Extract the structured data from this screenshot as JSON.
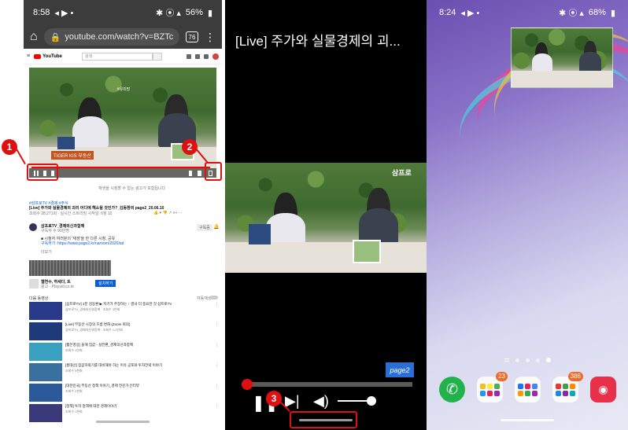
{
  "browser": {
    "status_time": "8:58",
    "status_right": "56%",
    "url": "youtube.com/watch?v=BZTc",
    "tab_count": "76",
    "search_placeholder": "검색"
  },
  "annotations": {
    "badge_1": "1",
    "badge_2": "2",
    "badge_3": "3"
  },
  "video_overlay": {
    "tag_text": "TIGER KIS 부동산",
    "sign_text": "#유미망"
  },
  "page": {
    "banner_text": "재생을 시청할 수 없는 광고가 포함됩니다",
    "video_title": "[Live] 주가와 실물경제의 괴리 어디에 해소될 것인가?_김동환의 page2_20.06.10",
    "video_meta": "조회수 28,271회 · 실시간 스트리밍 시작일: 6월 10",
    "channel_name": "삼프로TV_경제의신과함께",
    "channel_sub": "구독자 수 90만명",
    "subscribe_label": "구독중",
    "desc_line_1": "■ 시청자 여러분의 '재생'을 한 다른 시청, 공유",
    "desc_line_2": "구독하기: https://www.page2.kr/naroom/2020/ad",
    "more_label": "더보기",
    "ad_title": "웹연수, 하세다, 트",
    "ad_sub": "광고 · Playvid.co.kr",
    "ad_button": "설치하기",
    "up_next_label": "다음 동영상",
    "autoplay_label": "자동재생"
  },
  "recommendations": [
    {
      "title": "[삼프로TV] 1분 김동환 ▶ 자기가 주장하는 ↑ 결국 더 중요한 것 삼프로TV",
      "sub": "삼프로TV_경제의신과함께 · 조회수 3만회",
      "thumb": "#2a3a8a"
    },
    {
      "title": "[Live] 부동산 시장의 흐름 변화 (Zoom 회의)",
      "sub": "삼프로TV_경제의신과함께 · 조회수 1.2만회",
      "thumb": "#1e3a7a"
    },
    {
      "title": "[짧은영상] 올해 집값 - 실전편_경제의신과함께",
      "sub": "조회수 1만회",
      "thumb": "#3aa0c0"
    },
    {
      "title": "[홍대선] 집값하락기를 대비해야 하는 이유 공포와 투자전략 이야기",
      "sub": "조회수 5천회",
      "thumb": "#3a70a0"
    },
    {
      "title": "[대한민국] 부동산 정책 이야기_경제 전문가 인터뷰",
      "sub": "조회수 2천회",
      "thumb": "#2a5a9a"
    },
    {
      "title": "[정책] 투자 정책에 대한 경제이야기",
      "sub": "조회수 1천회",
      "thumb": "#3a3a7a"
    }
  ],
  "player": {
    "title": "[Live] 주가와 실물경제의 괴...",
    "logo_text": "page2",
    "progress": 0.02,
    "volume": 0.9
  },
  "home": {
    "status_time": "8:24",
    "status_right": "68%",
    "dock_badges": [
      "23",
      "386"
    ]
  },
  "colors": {
    "highlight": "#e01010",
    "youtube_red": "#ff0000",
    "link_blue": "#065fd4"
  }
}
